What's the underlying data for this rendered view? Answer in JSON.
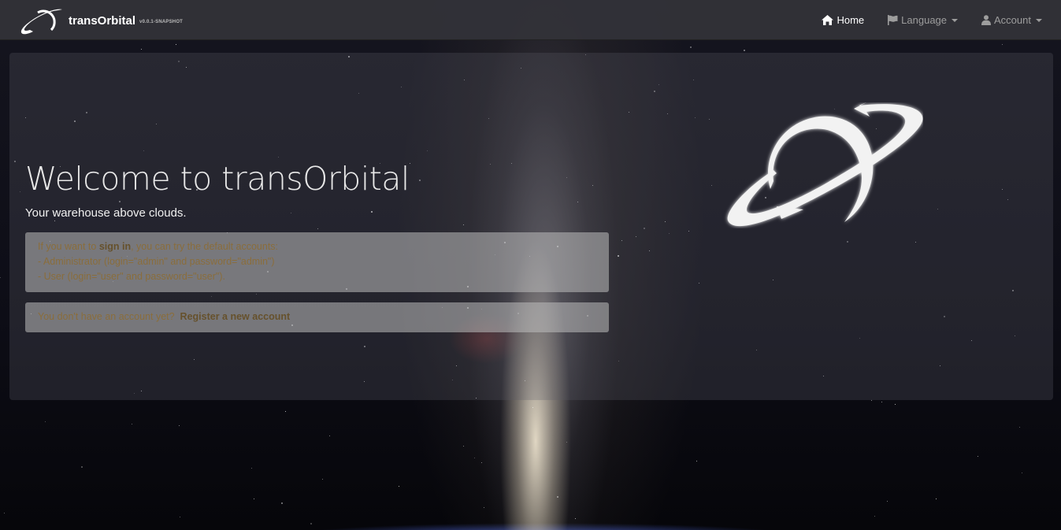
{
  "brand": {
    "name": "transOrbital",
    "version": "v0.0.1-SNAPSHOT",
    "logo_icon": "orbit-logo-icon"
  },
  "nav": {
    "home": {
      "label": "Home",
      "icon": "home-icon"
    },
    "language": {
      "label": "Language",
      "icon": "flag-icon"
    },
    "account": {
      "label": "Account",
      "icon": "user-icon"
    }
  },
  "hero": {
    "title": "Welcome to transOrbital",
    "tagline": "Your warehouse above clouds.",
    "signin_intro_before": "If you want to ",
    "signin_link": "sign in",
    "signin_intro_after": ", you can try the default accounts:",
    "admin_line": "- Administrator (login=\"admin\" and password=\"admin\")",
    "user_line": "- User (login=\"user\" and password=\"user\").",
    "register_prompt": "You don't have an account yet?",
    "register_link": "Register a new account"
  },
  "colors": {
    "navbar": "#323238",
    "alert_text": "#8a6d3b",
    "link_text": "#66512c"
  }
}
